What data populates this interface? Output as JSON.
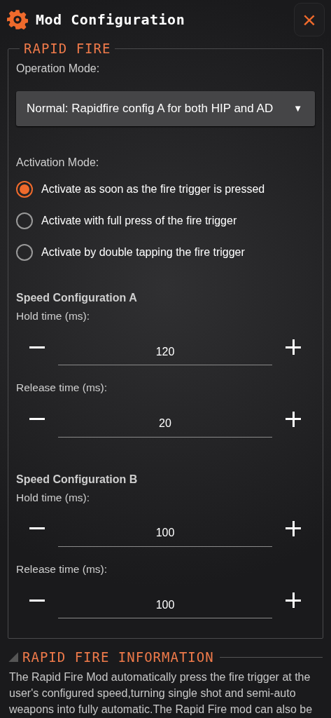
{
  "header": {
    "title": "Mod Configuration",
    "close": "×"
  },
  "section": {
    "legend": "RAPID FIRE",
    "operation_label": "Operation Mode:",
    "operation_dropdown": {
      "value": "Normal: Rapidfire config A for both HIP and AD",
      "caret": "▼"
    },
    "activation_label": "Activation Mode:",
    "activation_options": [
      {
        "label": "Activate as soon as the fire trigger is pressed",
        "selected": true
      },
      {
        "label": "Activate with full press of the fire trigger",
        "selected": false
      },
      {
        "label": "Activate by double tapping the fire trigger",
        "selected": false
      }
    ],
    "configs": [
      {
        "heading": "Speed Configuration A",
        "fields": [
          {
            "label": "Hold time (ms):",
            "value": "120"
          },
          {
            "label": "Release time (ms):",
            "value": "20"
          }
        ]
      },
      {
        "heading": "Speed Configuration B",
        "fields": [
          {
            "label": "Hold time (ms):",
            "value": "100"
          },
          {
            "label": "Release time (ms):",
            "value": "100"
          }
        ]
      }
    ]
  },
  "info": {
    "heading": "RAPID FIRE INFORMATION",
    "text": "The Rapid Fire Mod automatically press the fire trigger at the user's configured speed,turning single shot and semi-auto weapons into fully automatic.The Rapid Fire mod can also be"
  }
}
